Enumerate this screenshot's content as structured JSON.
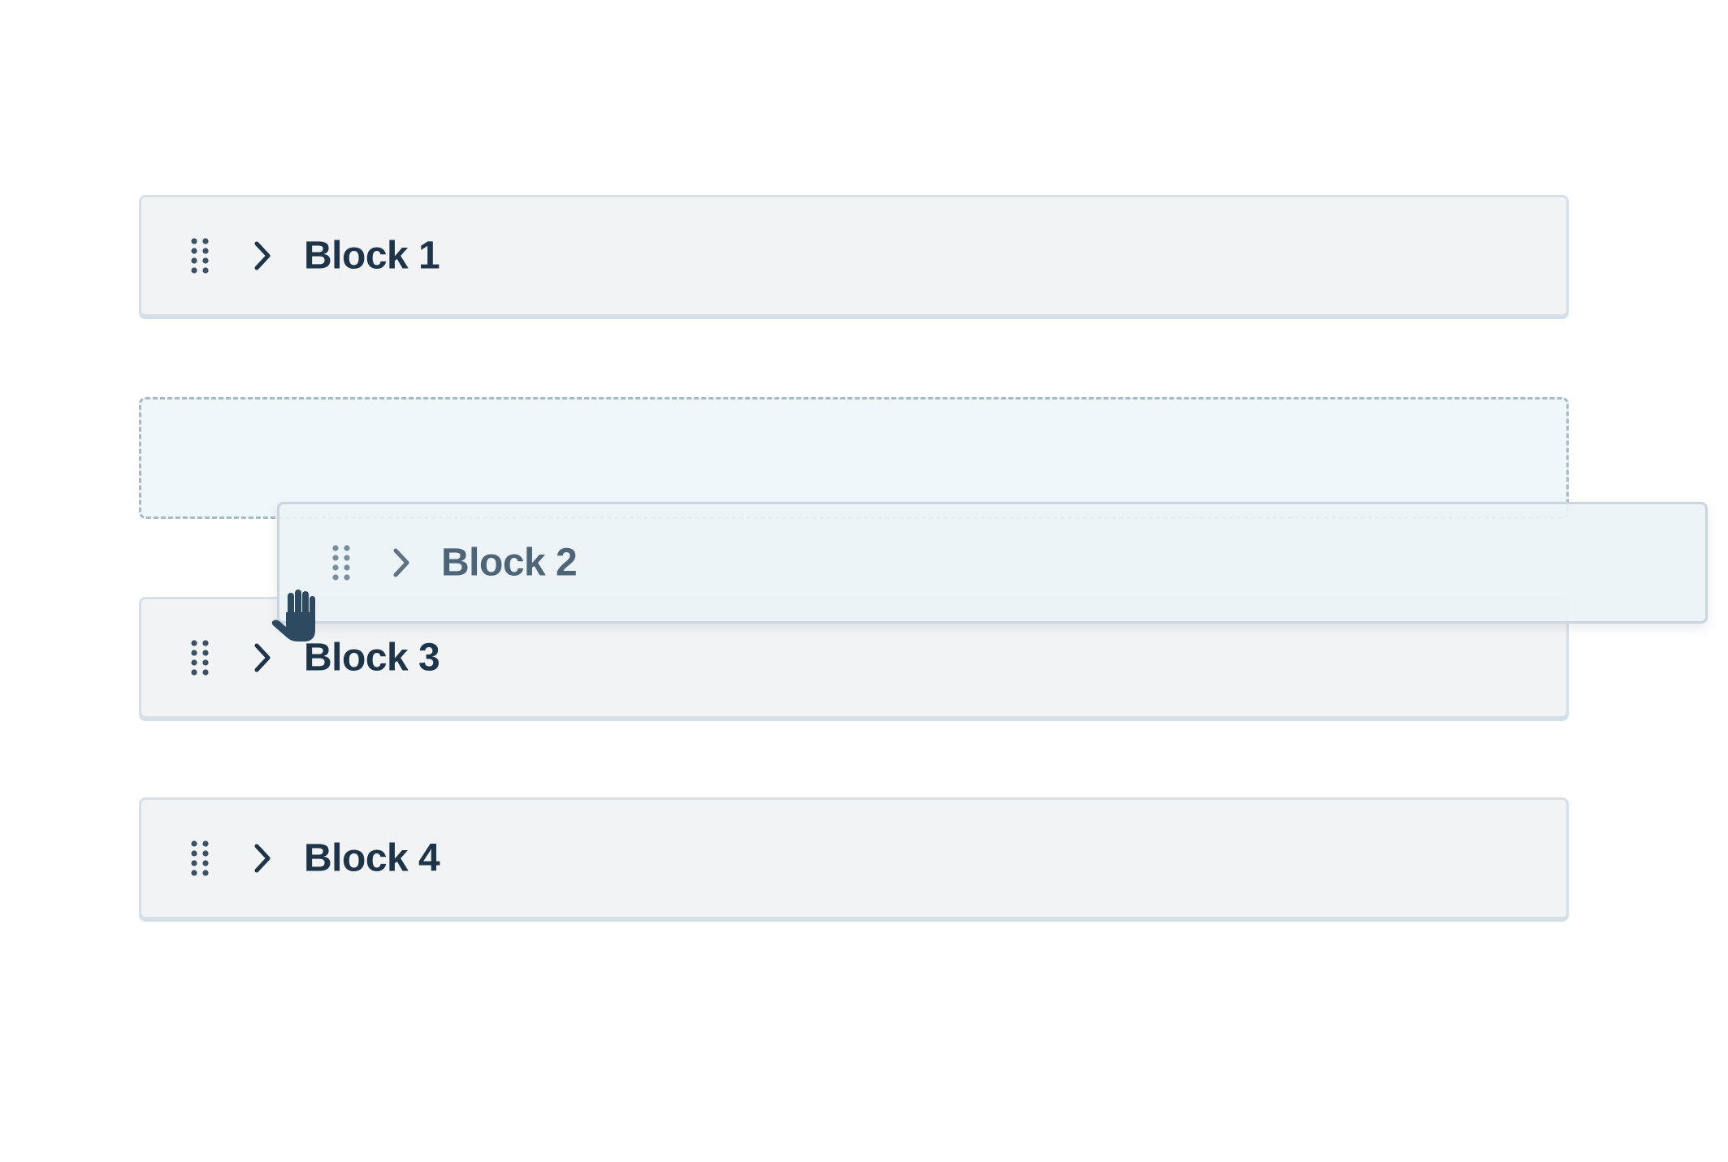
{
  "blocks": [
    {
      "label": "Block 1",
      "handle_icon": "drag-handle-icon",
      "expand_icon": "chevron-right-icon"
    },
    {
      "label": "Block 3",
      "handle_icon": "drag-handle-icon",
      "expand_icon": "chevron-right-icon"
    },
    {
      "label": "Block 4",
      "handle_icon": "drag-handle-icon",
      "expand_icon": "chevron-right-icon"
    }
  ],
  "dragging": {
    "label": "Block 2",
    "handle_icon": "drag-handle-icon",
    "expand_icon": "chevron-right-icon",
    "cursor_icon": "grab-hand-cursor-icon"
  },
  "colors": {
    "block_background": "#f2f3f5",
    "block_border": "#d6e0e8",
    "label_text": "#1e3448",
    "placeholder_background": "#eef7f9",
    "placeholder_border": "#aab9c6",
    "ghost_label_text": "#4f6577"
  }
}
